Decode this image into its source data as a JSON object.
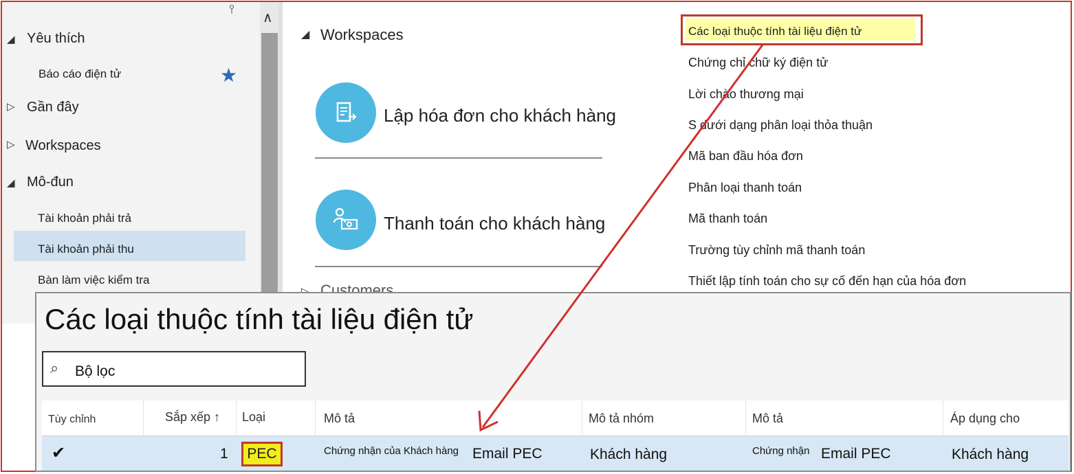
{
  "sidebar": {
    "favorites_label": "Yêu thích",
    "favorite_item": "Báo cáo điện tử",
    "recent_label": "Gần đây",
    "workspaces_label": "Workspaces",
    "modules_label": "Mô-đun",
    "modules": [
      "Tài khoản phải trả",
      "Tài khoản phải thu",
      "Bàn làm việc kiểm tra"
    ],
    "selected_module": "Tài khoản phải thu"
  },
  "workspaces": {
    "title": "Workspaces",
    "tiles": [
      "Lập hóa đơn cho khách hàng",
      "Thanh toán cho khách hàng"
    ],
    "customers_label": "Customers",
    "tile_color": "#4fb8e0"
  },
  "links": [
    "Các loại thuộc tính tài liệu điện tử",
    "Chứng chỉ chữ ký điện tử",
    "Lời chào thương mại",
    "S dưới dạng phân loại thỏa thuận",
    "Mã ban đầu hóa đơn",
    "Phân loại thanh toán",
    "Mã thanh toán",
    "Trường tùy chỉnh mã thanh toán",
    "Thiết lập tính toán cho sự cố đến hạn của hóa đơn"
  ],
  "highlighted_link": "Các loại thuộc tính tài liệu điện tử",
  "panel": {
    "title": "Các loại thuộc tính tài liệu điện tử",
    "filter_placeholder": "Bộ lọc",
    "columns": [
      "Tùy chỉnh",
      "Sắp xếp ↑",
      "Loại",
      "Mô tả",
      "Mô tả nhóm",
      "Mô tả",
      "Áp dụng cho"
    ],
    "row": {
      "custom": "✔",
      "sort": "1",
      "type": "PEC",
      "desc_small": "Chứng nhận của Khách hàng",
      "desc": "Email PEC",
      "group_desc": "Khách hàng",
      "desc2_small": "Chứng nhận",
      "desc2": "Email PEC",
      "applies_to": "Khách hàng"
    }
  },
  "colors": {
    "accent_red": "#c0392b",
    "highlight_yellow": "#ffffa8",
    "selected_row": "#d7e7f5"
  }
}
